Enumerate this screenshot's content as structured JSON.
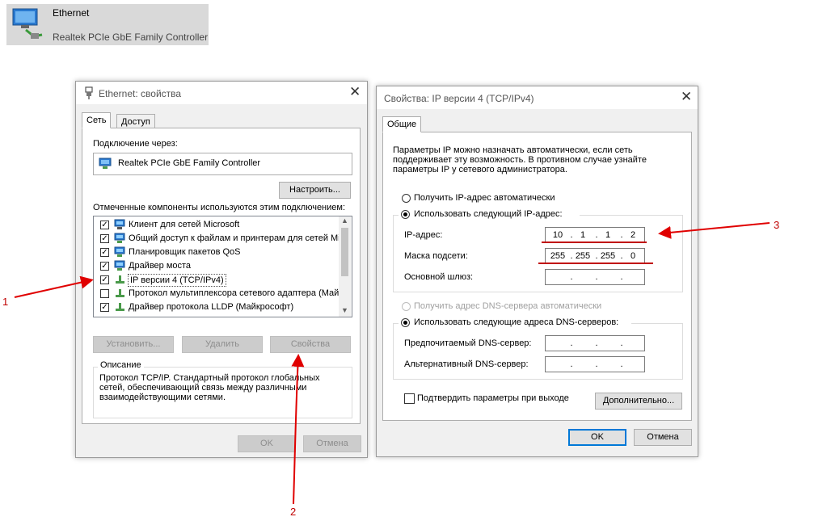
{
  "ethernet_tile": {
    "name": "Ethernet",
    "description": "Realtek PCIe GbE Family Controller"
  },
  "eth_dialog": {
    "title": "Ethernet: свойства",
    "tabs": [
      "Сеть",
      "Доступ"
    ],
    "connect_via_label": "Подключение через:",
    "adapter_name": "Realtek PCIe GbE Family Controller",
    "configure_button": "Настроить...",
    "components_label": "Отмеченные компоненты используются этим подключением:",
    "components": [
      {
        "label": "Клиент для сетей Microsoft",
        "checked": true
      },
      {
        "label": "Общий доступ к файлам и принтерам для сетей Mi",
        "checked": true
      },
      {
        "label": "Планировщик пакетов QoS",
        "checked": true
      },
      {
        "label": "Драйвер моста",
        "checked": true
      },
      {
        "label": "IP версии 4 (TCP/IPv4)",
        "checked": true,
        "selected": true
      },
      {
        "label": "Протокол мультиплексора сетевого адаптера (Май",
        "checked": false
      },
      {
        "label": "Драйвер протокола LLDP (Майкрософт)",
        "checked": true
      }
    ],
    "install_button": "Установить...",
    "remove_button": "Удалить",
    "properties_button": "Свойства",
    "description_legend": "Описание",
    "description_text": "Протокол TCP/IP. Стандартный протокол глобальных сетей, обеспечивающий связь между различными взаимодействующими сетями.",
    "ok_button": "OK",
    "cancel_button": "Отмена"
  },
  "ipv4_dialog": {
    "title": "Свойства: IP версии 4 (TCP/IPv4)",
    "tab": "Общие",
    "intro": "Параметры IP можно назначать автоматически, если сеть поддерживает эту возможность. В противном случае узнайте параметры IP у сетевого администратора.",
    "auto_ip_label": "Получить IP-адрес автоматически",
    "manual_ip_label": "Использовать следующий IP-адрес:",
    "ip_label": "IP-адрес:",
    "ip_octets": [
      "10",
      "1",
      "1",
      "2"
    ],
    "mask_label": "Маска подсети:",
    "mask_octets": [
      "255",
      "255",
      "255",
      "0"
    ],
    "gateway_label": "Основной шлюз:",
    "auto_dns_label": "Получить адрес DNS-сервера автоматически",
    "manual_dns_label": "Использовать следующие адреса DNS-серверов:",
    "preferred_dns_label": "Предпочитаемый DNS-сервер:",
    "alternate_dns_label": "Альтернативный DNS-сервер:",
    "validate_label": "Подтвердить параметры при выходе",
    "advanced_button": "Дополнительно...",
    "ok_button": "OK",
    "cancel_button": "Отмена"
  },
  "annotations": [
    "1",
    "2",
    "3"
  ],
  "colors": {
    "annotation": "#e00000",
    "accent": "#0078d7"
  }
}
